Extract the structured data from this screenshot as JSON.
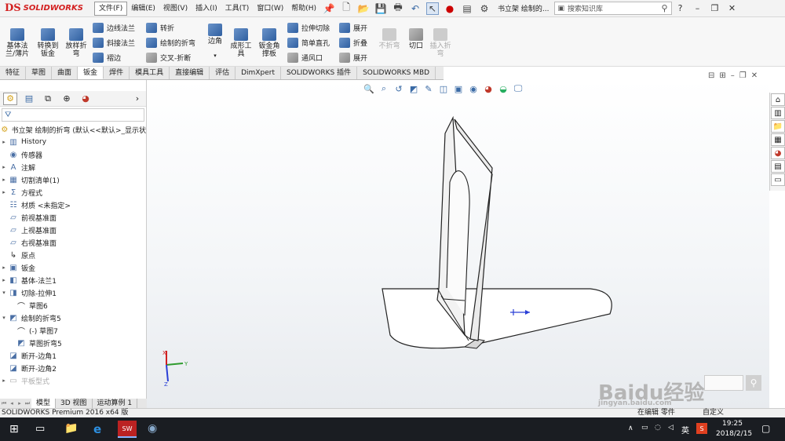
{
  "app": {
    "logo_mark": "DS",
    "logo_text": "SOLIDWORKS",
    "doc_title": "书立架 绘制的..."
  },
  "menu": [
    "文件(F)",
    "编辑(E)",
    "视图(V)",
    "插入(I)",
    "工具(T)",
    "窗口(W)",
    "帮助(H)"
  ],
  "search": {
    "placeholder": "搜索知识库"
  },
  "ribbon": {
    "big": [
      {
        "label": "基体法兰/薄片"
      },
      {
        "label": "转换到钣金"
      },
      {
        "label": "放样折弯"
      },
      {
        "label": "边角"
      },
      {
        "label": "成形工具"
      },
      {
        "label": "钣金角撑板"
      },
      {
        "label": "不折弯"
      },
      {
        "label": "切口"
      },
      {
        "label": "插入折弯"
      }
    ],
    "small": [
      {
        "label": "边线法兰"
      },
      {
        "label": "斜接法兰"
      },
      {
        "label": "褶边"
      },
      {
        "label": "转折"
      },
      {
        "label": "绘制的折弯"
      },
      {
        "label": "交叉-折断"
      },
      {
        "label": "拉伸切除"
      },
      {
        "label": "简单直孔"
      },
      {
        "label": "通风口"
      },
      {
        "label": "展开"
      },
      {
        "label": "折叠"
      },
      {
        "label": "展开"
      }
    ]
  },
  "tabs": [
    "特征",
    "草图",
    "曲面",
    "钣金",
    "焊件",
    "模具工具",
    "直接编辑",
    "评估",
    "DimXpert",
    "SOLIDWORKS 插件",
    "SOLIDWORKS MBD"
  ],
  "tree": {
    "root": "书立架 绘制的折弯  (默认<<默认>_显示状",
    "items": [
      {
        "label": "History"
      },
      {
        "label": "传感器"
      },
      {
        "label": "注解"
      },
      {
        "label": "切割清单(1)"
      },
      {
        "label": "方程式"
      },
      {
        "label": "材质 <未指定>"
      },
      {
        "label": "前视基准面"
      },
      {
        "label": "上视基准面"
      },
      {
        "label": "右视基准面"
      },
      {
        "label": "原点"
      },
      {
        "label": "钣金"
      },
      {
        "label": "基体-法兰1"
      },
      {
        "label": "切除-拉伸1"
      },
      {
        "label": "草图6"
      },
      {
        "label": "绘制的折弯5"
      },
      {
        "label": "(-) 草图7"
      },
      {
        "label": "草图折弯5"
      },
      {
        "label": "断开-边角1"
      },
      {
        "label": "断开-边角2"
      },
      {
        "label": "平板型式"
      }
    ]
  },
  "bottom_tabs": [
    "模型",
    "3D 视图",
    "运动算例 1"
  ],
  "status": {
    "left": "SOLIDWORKS Premium 2016 x64 版",
    "mid1": "在编辑 零件",
    "mid2": "自定义"
  },
  "taskbar": {
    "time": "19:25",
    "date": "2018/2/15",
    "ime": "英"
  },
  "watermark": {
    "brand": "Baidu经验",
    "url": "jingyan.baidu.com"
  },
  "colors": {
    "accent": "#d32020",
    "selected_tab": "#ffffff",
    "taskbar": "#1a1d22"
  }
}
